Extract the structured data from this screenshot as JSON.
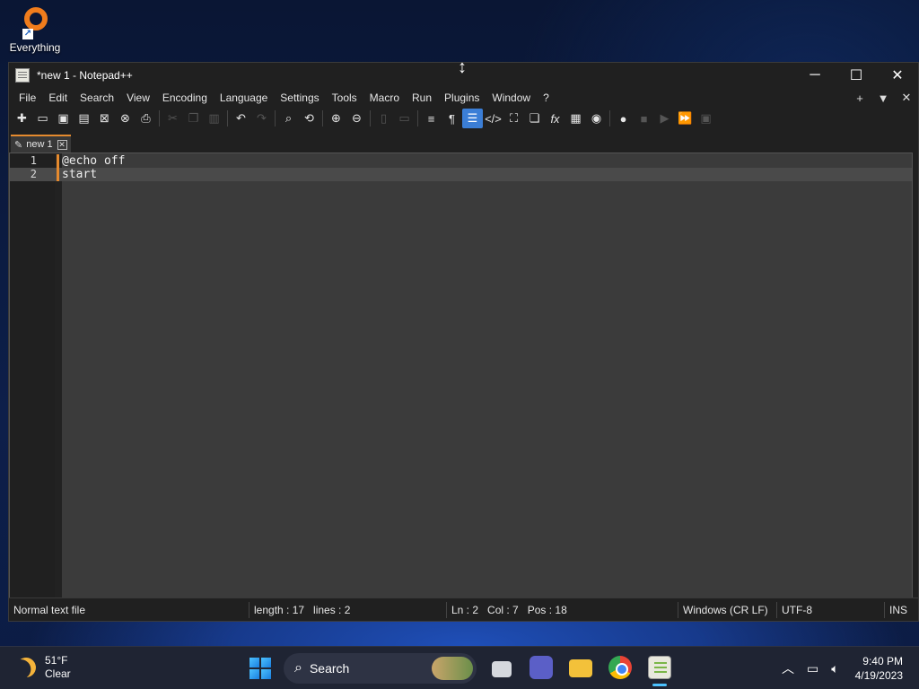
{
  "desktop": {
    "icons": [
      {
        "label": "Everything",
        "icon": "everything-icon"
      }
    ]
  },
  "window": {
    "title": "*new 1 - Notepad++",
    "controls": {
      "minimize": "─",
      "maximize": "☐",
      "close": "✕"
    }
  },
  "menubar": {
    "items": [
      "File",
      "Edit",
      "Search",
      "View",
      "Encoding",
      "Language",
      "Settings",
      "Tools",
      "Macro",
      "Run",
      "Plugins",
      "Window",
      "?"
    ],
    "right": {
      "add": "+",
      "list": "▼",
      "close": "✕"
    }
  },
  "toolbar": {
    "buttons": [
      "new-file-icon",
      "open-file-icon",
      "save-icon",
      "save-all-icon",
      "close-icon",
      "close-all-icon",
      "print-icon",
      "cut-icon",
      "copy-icon",
      "paste-icon",
      "undo-icon",
      "redo-icon",
      "find-icon",
      "replace-icon",
      "zoom-in-icon",
      "zoom-out-icon",
      "sync-vertical-icon",
      "sync-horizontal-icon",
      "word-wrap-icon",
      "show-all-chars-icon",
      "indent-guide-icon",
      "language-icon",
      "doc-map-icon",
      "doc-list-icon",
      "function-list-icon",
      "folder-workspace-icon",
      "monitor-icon",
      "record-macro-icon",
      "stop-macro-icon",
      "play-macro-icon",
      "run-macro-multiple-icon",
      "save-macro-icon"
    ]
  },
  "tabs": [
    {
      "label": "new 1",
      "close": "✕",
      "modified": true
    }
  ],
  "editor": {
    "lines": [
      {
        "num": "1",
        "text": "@echo off"
      },
      {
        "num": "2",
        "text": "start"
      }
    ],
    "current_line": 2
  },
  "statusbar": {
    "file_type": "Normal text file",
    "length": "length : 17",
    "lines": "lines : 2",
    "ln": "Ln : 2",
    "col": "Col : 7",
    "pos": "Pos : 18",
    "eol": "Windows (CR LF)",
    "encoding": "UTF-8",
    "mode": "INS"
  },
  "taskbar": {
    "weather": {
      "temp": "51°F",
      "condition": "Clear"
    },
    "search_label": "Search",
    "clock": {
      "time": "9:40 PM",
      "date": "4/19/2023"
    }
  },
  "colors": {
    "accent": "#e58a2e",
    "toolbar_active": "#3b7ed6",
    "editor_bg": "#3b3b3b",
    "chrome_bg": "#202020"
  }
}
